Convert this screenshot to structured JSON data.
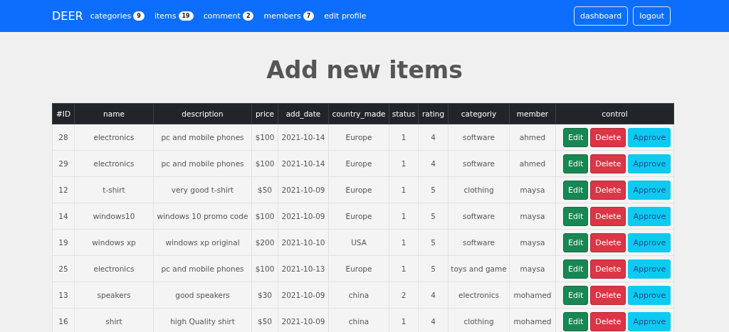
{
  "navbar": {
    "brand": "DEER",
    "links": [
      {
        "label": "categories",
        "badge": "9"
      },
      {
        "label": "items",
        "badge": "19"
      },
      {
        "label": "comment",
        "badge": "2"
      },
      {
        "label": "members",
        "badge": "7"
      },
      {
        "label": "edit profile"
      }
    ],
    "buttons": [
      "dashboard",
      "logout"
    ]
  },
  "heading": "Add new items",
  "table": {
    "columns": [
      "#ID",
      "name",
      "description",
      "price",
      "add_date",
      "country_made",
      "status",
      "rating",
      "categoriy",
      "member",
      "control"
    ],
    "rows": [
      {
        "cells": [
          "28",
          "electronics",
          "pc and mobile phones",
          "$100",
          "2021-10-14",
          "Europe",
          "1",
          "4",
          "software",
          "ahmed"
        ],
        "actions": [
          {
            "kind": "edit",
            "label": "Edit"
          },
          {
            "kind": "delete",
            "label": "Delete"
          },
          {
            "kind": "approve",
            "label": "Approve"
          }
        ]
      },
      {
        "cells": [
          "29",
          "electronics",
          "pc and mobile phones",
          "$100",
          "2021-10-14",
          "Europe",
          "1",
          "4",
          "software",
          "ahmed"
        ],
        "actions": [
          {
            "kind": "edit",
            "label": "Edit"
          },
          {
            "kind": "delete",
            "label": "Delete"
          },
          {
            "kind": "approve",
            "label": "Approve"
          }
        ]
      },
      {
        "cells": [
          "12",
          "t-shirt",
          "very good t-shirt",
          "$50",
          "2021-10-09",
          "Europe",
          "1",
          "5",
          "clothing",
          "maysa"
        ],
        "actions": [
          {
            "kind": "edit",
            "label": "Edit"
          },
          {
            "kind": "delete",
            "label": "Delete"
          },
          {
            "kind": "approve",
            "label": "Approve"
          }
        ]
      },
      {
        "cells": [
          "14",
          "windows10",
          "windows 10 promo code",
          "$100",
          "2021-10-09",
          "Europe",
          "1",
          "5",
          "software",
          "maysa"
        ],
        "actions": [
          {
            "kind": "edit",
            "label": "Edit"
          },
          {
            "kind": "delete",
            "label": "Delete"
          },
          {
            "kind": "approve",
            "label": "Approve"
          }
        ]
      },
      {
        "cells": [
          "19",
          "windows xp",
          "windows xp original",
          "$200",
          "2021-10-10",
          "USA",
          "1",
          "5",
          "software",
          "maysa"
        ],
        "actions": [
          {
            "kind": "edit",
            "label": "Edit"
          },
          {
            "kind": "delete",
            "label": "Delete"
          },
          {
            "kind": "approve",
            "label": "Approve"
          }
        ]
      },
      {
        "cells": [
          "25",
          "electronics",
          "pc and mobile phones",
          "$100",
          "2021-10-13",
          "Europe",
          "1",
          "5",
          "toys and game",
          "maysa"
        ],
        "actions": [
          {
            "kind": "edit",
            "label": "Edit"
          },
          {
            "kind": "delete",
            "label": "Delete"
          },
          {
            "kind": "approve",
            "label": "Approve"
          }
        ]
      },
      {
        "cells": [
          "13",
          "speakers",
          "good speakers",
          "$30",
          "2021-10-09",
          "china",
          "2",
          "4",
          "electronics",
          "mohamed"
        ],
        "actions": [
          {
            "kind": "edit",
            "label": "Edit"
          },
          {
            "kind": "delete",
            "label": "Delete"
          },
          {
            "kind": "approve",
            "label": "Approve"
          }
        ]
      },
      {
        "cells": [
          "16",
          "shirt",
          "high Quality shirt",
          "$50",
          "2021-10-09",
          "china",
          "1",
          "4",
          "clothing",
          "mohamed"
        ],
        "actions": [
          {
            "kind": "edit",
            "label": "Edit"
          },
          {
            "kind": "delete",
            "label": "Delete"
          },
          {
            "kind": "approve",
            "label": "Approve"
          }
        ]
      }
    ]
  }
}
